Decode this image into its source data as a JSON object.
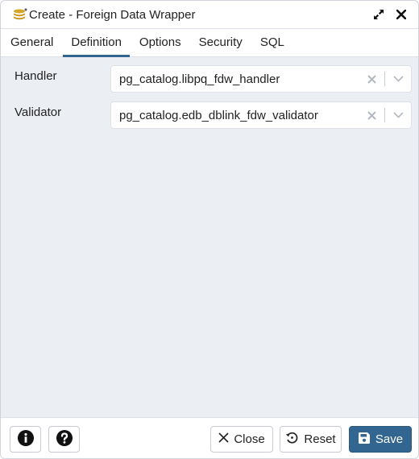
{
  "dialog": {
    "title": "Create - Foreign Data Wrapper",
    "icons": {
      "title": "database-stack-icon",
      "expand": "expand-icon",
      "close": "close-icon"
    }
  },
  "tabs": [
    {
      "label": "General",
      "active": false
    },
    {
      "label": "Definition",
      "active": true
    },
    {
      "label": "Options",
      "active": false
    },
    {
      "label": "Security",
      "active": false
    },
    {
      "label": "SQL",
      "active": false
    }
  ],
  "form": {
    "handler": {
      "label": "Handler",
      "value": "pg_catalog.libpq_fdw_handler"
    },
    "validator": {
      "label": "Validator",
      "value": "pg_catalog.edb_dblink_fdw_validator"
    }
  },
  "footer": {
    "info_icon": "info-icon",
    "help_icon": "help-icon",
    "close_label": "Close",
    "reset_label": "Reset",
    "save_label": "Save"
  },
  "colors": {
    "primary": "#326690",
    "background": "#ebeef3"
  }
}
